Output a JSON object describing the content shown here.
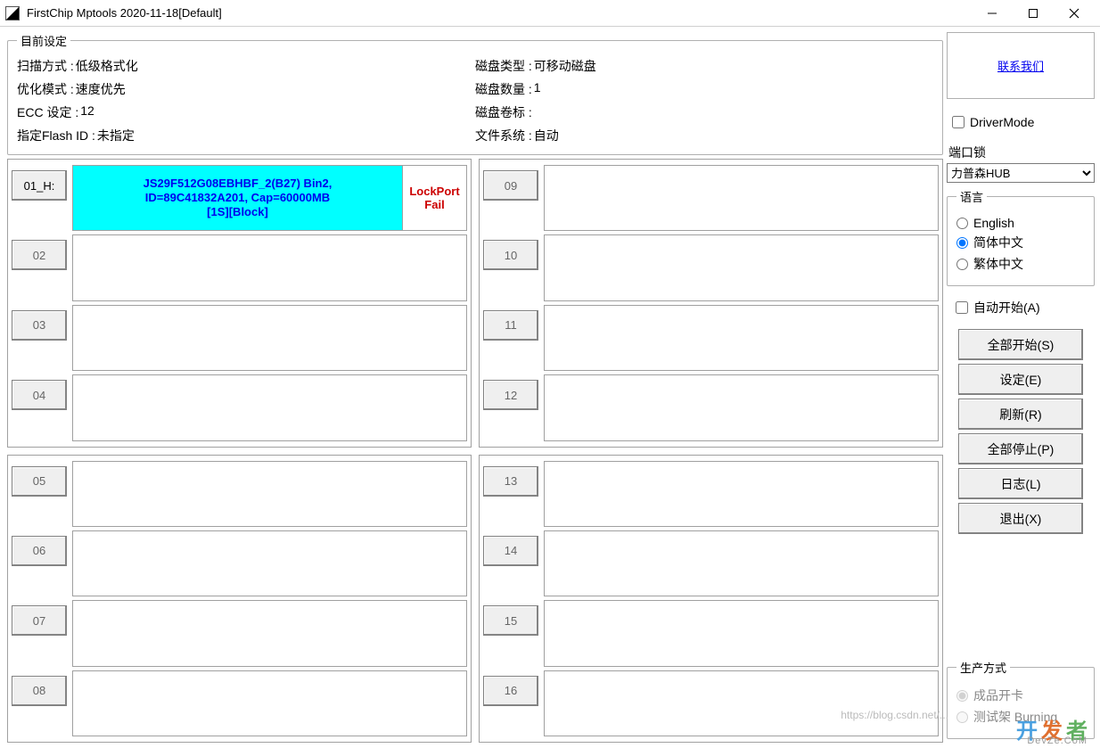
{
  "window": {
    "title": "FirstChip Mptools    2020-11-18[Default]"
  },
  "settings": {
    "legend": "目前设定",
    "rows_left": [
      {
        "k": "扫描方式 :",
        "v": "低级格式化"
      },
      {
        "k": "优化模式 :",
        "v": "速度优先"
      },
      {
        "k": "ECC 设定 :",
        "v": "12"
      },
      {
        "k": "指定Flash ID :",
        "v": "未指定"
      }
    ],
    "rows_right": [
      {
        "k": "磁盘类型 :",
        "v": "可移动磁盘"
      },
      {
        "k": "磁盘数量 :",
        "v": "1"
      },
      {
        "k": "磁盘卷标 :",
        "v": ""
      },
      {
        "k": "文件系统 :",
        "v": "自动"
      }
    ]
  },
  "contact_label": "联系我们",
  "driver_mode_label": "DriverMode",
  "port_lock": {
    "label": "端口锁",
    "selected": "力普森HUB"
  },
  "language": {
    "legend": "语言",
    "options": [
      "English",
      "简体中文",
      "繁体中文"
    ],
    "selected": "简体中文"
  },
  "auto_start_label": "自动开始(A)",
  "side_buttons": [
    "全部开始(S)",
    "设定(E)",
    "刷新(R)",
    "全部停止(P)",
    "日志(L)",
    "退出(X)"
  ],
  "production": {
    "legend": "生产方式",
    "options": [
      "成品开卡",
      "测试架 Burning"
    ]
  },
  "slots": [
    {
      "id": "01_H:",
      "active": true,
      "info_lines": [
        "JS29F512G08EBHBF_2(B27)  Bin2,",
        "ID=89C41832A201, Cap=60000MB",
        "[1S][Block]"
      ],
      "status_lines": [
        "LockPort",
        "Fail"
      ]
    },
    {
      "id": "02"
    },
    {
      "id": "03"
    },
    {
      "id": "04"
    },
    {
      "id": "05"
    },
    {
      "id": "06"
    },
    {
      "id": "07"
    },
    {
      "id": "08"
    },
    {
      "id": "09"
    },
    {
      "id": "10"
    },
    {
      "id": "11"
    },
    {
      "id": "12"
    },
    {
      "id": "13"
    },
    {
      "id": "14"
    },
    {
      "id": "15"
    },
    {
      "id": "16"
    }
  ],
  "watermark": {
    "text": "开发者",
    "sub": "DevZe.CoM",
    "mid": "https://blog.csdn.net/..."
  }
}
